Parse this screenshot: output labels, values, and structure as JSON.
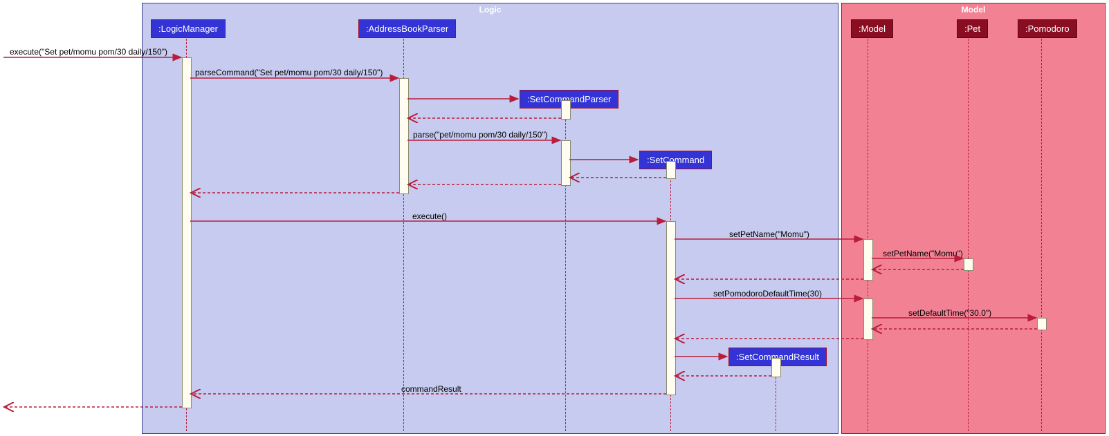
{
  "frames": {
    "logic": {
      "label": "Logic"
    },
    "model": {
      "label": "Model"
    }
  },
  "participants": {
    "logicManager": ":LogicManager",
    "addressBookParser": ":AddressBookParser",
    "setCommandParser": ":SetCommandParser",
    "setCommand": ":SetCommand",
    "setCommandResult": ":SetCommandResult",
    "model": ":Model",
    "pet": ":Pet",
    "pomodoro": ":Pomodoro"
  },
  "messages": {
    "execIn": "execute(\"Set pet/momu pom/30 daily/150\")",
    "parseCommand": "parseCommand(\"Set pet/momu pom/30 daily/150\")",
    "parse": "parse(\"pet/momu pom/30 daily/150\")",
    "execute": "execute()",
    "setPetName1": "setPetName(\"Momu\")",
    "setPetName2": "setPetName(\"Momu\")",
    "setPomDef": "setPomodoroDefaultTime(30)",
    "setDefTime": "setDefaultTime(\"30.0\")",
    "commandResult": "commandResult"
  }
}
